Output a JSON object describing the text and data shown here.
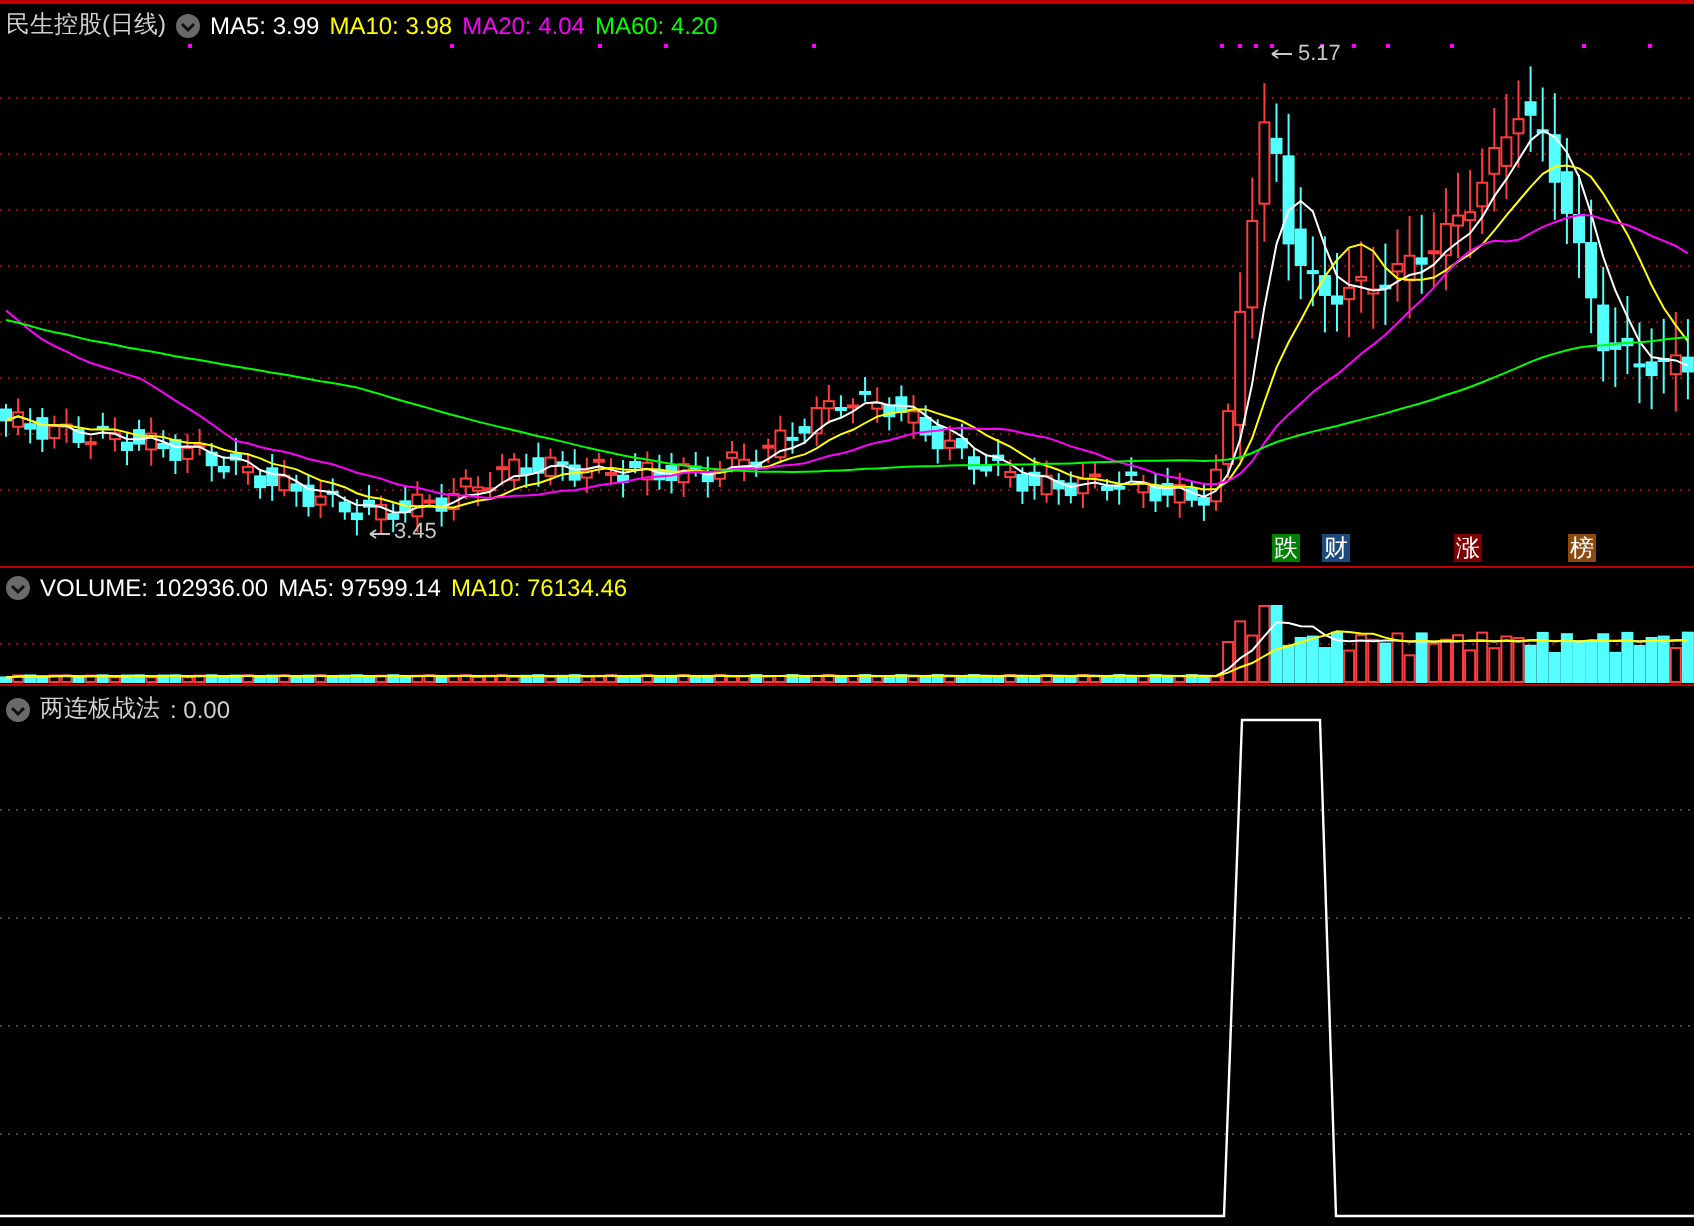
{
  "main_panel": {
    "title": "民生控股(日线)",
    "indicators": [
      {
        "label": "MA5: 3.99",
        "color": "#ffffff"
      },
      {
        "label": "MA10: 3.98",
        "color": "#ffff00"
      },
      {
        "label": "MA20: 4.04",
        "color": "#ff00ff"
      },
      {
        "label": "MA60: 4.20",
        "color": "#00ff00"
      }
    ],
    "high_label": "5.17",
    "low_label": "3.45",
    "markers": [
      {
        "text": "跌",
        "color": "#008000"
      },
      {
        "text": "财",
        "color": "#1c4a7c"
      },
      {
        "text": "涨",
        "color": "#7c0000"
      },
      {
        "text": "榜",
        "color": "#8a4a10"
      }
    ]
  },
  "volume_panel": {
    "indicators": [
      {
        "label": "VOLUME: 102936.00",
        "color": "#ffffff"
      },
      {
        "label": "MA5: 97599.14",
        "color": "#ffffff"
      },
      {
        "label": "MA10: 76134.46",
        "color": "#ffff00"
      }
    ]
  },
  "signal_panel": {
    "title": "两连板战法",
    "value": ": 0.00"
  }
}
